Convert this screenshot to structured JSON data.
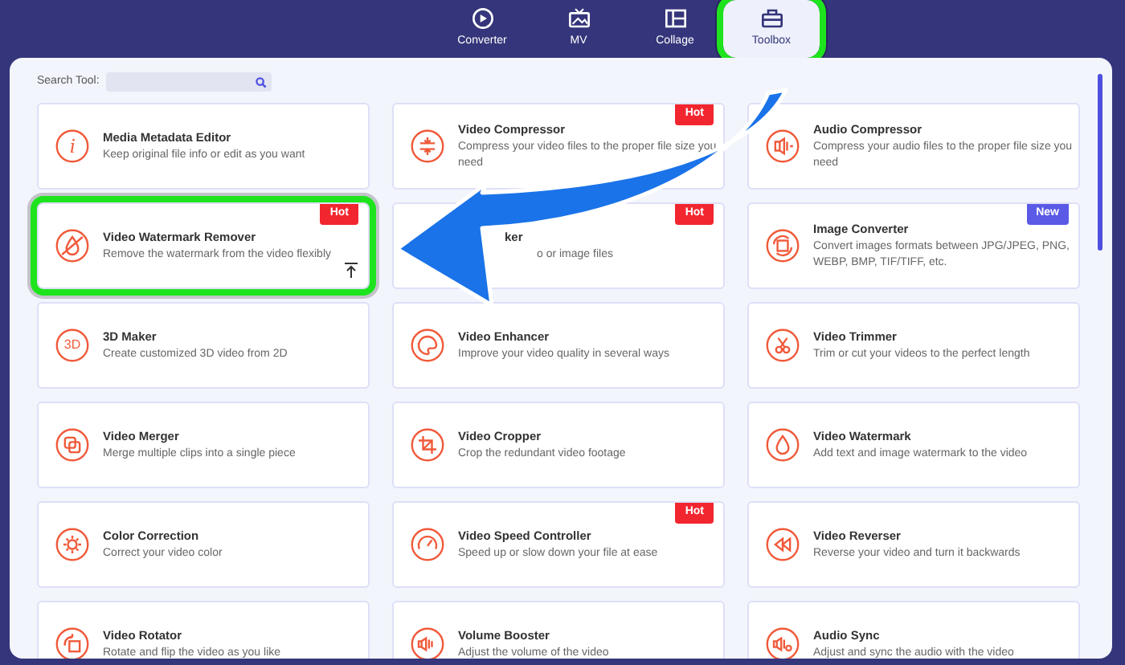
{
  "tabs": [
    {
      "label": "Converter",
      "selected": false
    },
    {
      "label": "MV",
      "selected": false
    },
    {
      "label": "Collage",
      "selected": false
    },
    {
      "label": "Toolbox",
      "selected": true,
      "highlighted": true
    }
  ],
  "search": {
    "label": "Search Tool:"
  },
  "tools": [
    {
      "kind": "full",
      "icon_text": "i",
      "title": "Media Metadata Editor",
      "description": "Keep original file info or edit as you want"
    },
    {
      "kind": "full",
      "title": "Video Compressor",
      "description": "Compress your video files to the proper file size you need",
      "badge": {
        "text": "Hot",
        "color": "#f2262f"
      }
    },
    {
      "kind": "full",
      "title": "Audio Compressor",
      "description": "Compress your audio files to the proper file size you need"
    },
    {
      "kind": "full",
      "title": "Video Watermark Remover",
      "description": "Remove the watermark from the video flexibly",
      "badge": {
        "text": "Hot",
        "color": "#f2262f"
      },
      "highlighted": true
    },
    {
      "kind": "covered",
      "title": "ker",
      "description": "o or image files",
      "badge": {
        "text": "Hot",
        "color": "#f2262f"
      }
    },
    {
      "kind": "full",
      "title": "Image Converter",
      "description": "Convert images formats between JPG/JPEG, PNG, WEBP, BMP, TIF/TIFF, etc.",
      "badge": {
        "text": "New",
        "color": "#5a5ae6"
      }
    },
    {
      "kind": "full",
      "icon_text": "3D",
      "title": "3D Maker",
      "description": "Create customized 3D video from 2D"
    },
    {
      "kind": "full",
      "title": "Video Enhancer",
      "description": "Improve your video quality in several ways"
    },
    {
      "kind": "full",
      "title": "Video Trimmer",
      "description": "Trim or cut your videos to the perfect length"
    },
    {
      "kind": "full",
      "title": "Video Merger",
      "description": "Merge multiple clips into a single piece"
    },
    {
      "kind": "full",
      "title": "Video Cropper",
      "description": "Crop the redundant video footage"
    },
    {
      "kind": "full",
      "title": "Video Watermark",
      "description": "Add text and image watermark to the video"
    },
    {
      "kind": "full",
      "title": "Color Correction",
      "description": "Correct your video color"
    },
    {
      "kind": "full",
      "title": "Video Speed Controller",
      "description": "Speed up or slow down your file at ease",
      "badge": {
        "text": "Hot",
        "color": "#f2262f"
      }
    },
    {
      "kind": "full",
      "title": "Video Reverser",
      "description": "Reverse your video and turn it backwards"
    },
    {
      "kind": "full",
      "title": "Video Rotator",
      "description": "Rotate and flip the video as you like"
    },
    {
      "kind": "full",
      "title": "Volume Booster",
      "description": "Adjust the volume of the video"
    },
    {
      "kind": "full",
      "title": "Audio Sync",
      "description": "Adjust and sync the audio with the video"
    }
  ]
}
